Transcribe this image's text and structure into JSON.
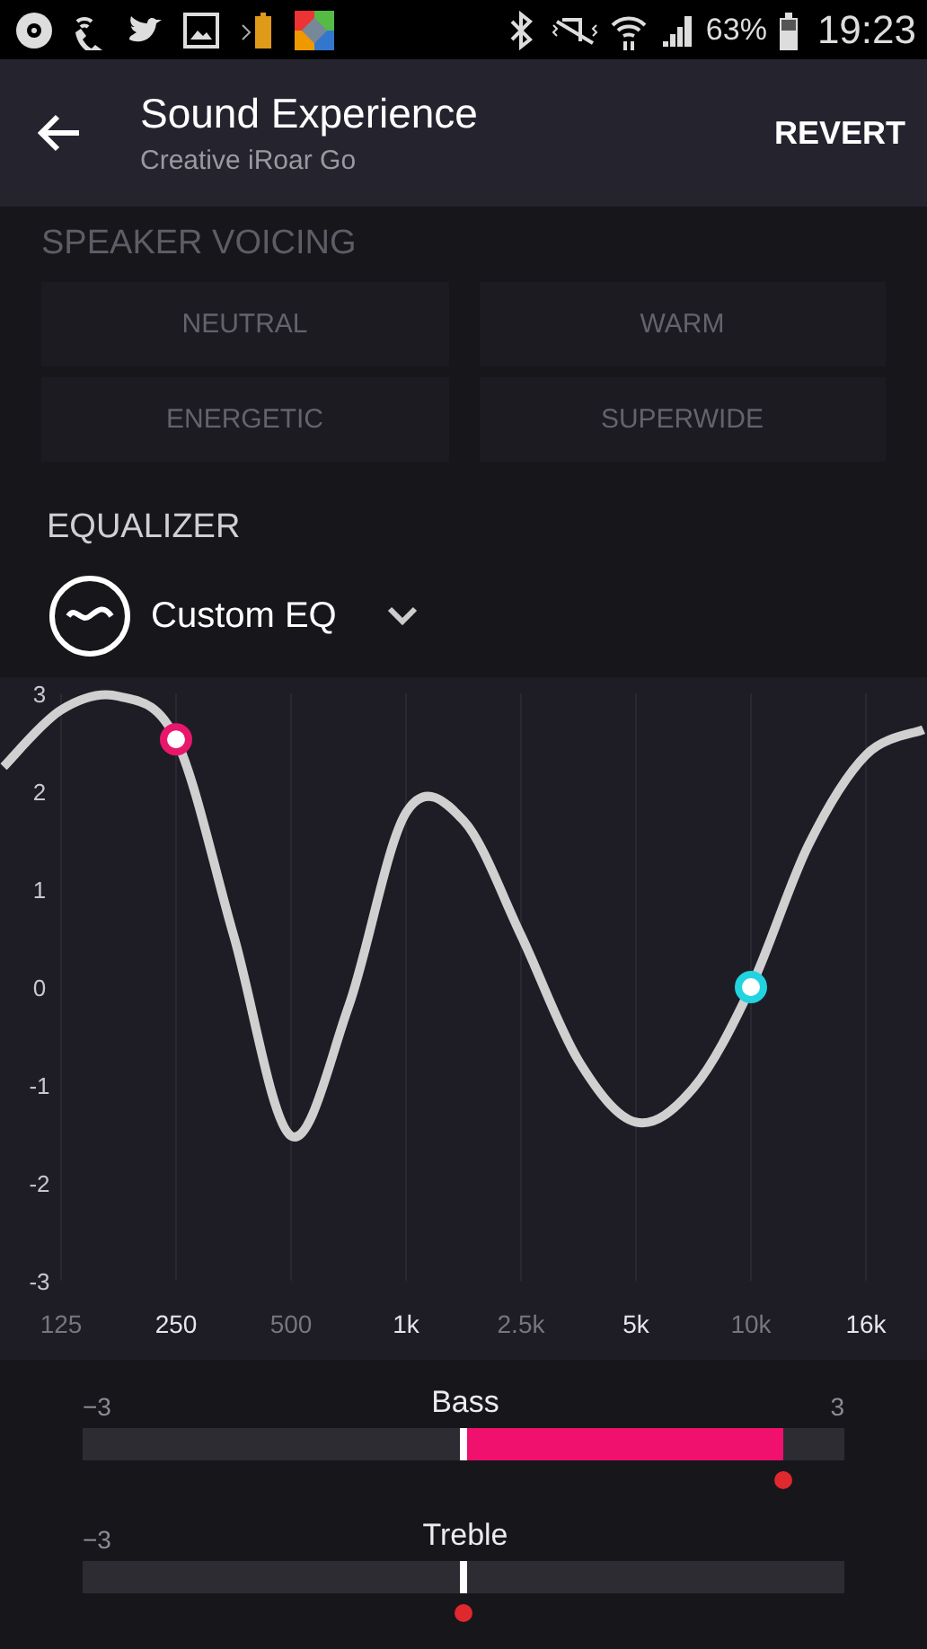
{
  "status_bar": {
    "battery": "63%",
    "time": "19:23"
  },
  "app_bar": {
    "title": "Sound Experience",
    "subtitle": "Creative iRoar Go",
    "action": "REVERT"
  },
  "speaker_voicing": {
    "heading": "SPEAKER VOICING",
    "options": [
      {
        "label": "NEUTRAL",
        "disabled": true
      },
      {
        "label": "WARM",
        "disabled": true
      },
      {
        "label": "ENERGETIC",
        "disabled": true
      },
      {
        "label": "SUPERWIDE",
        "disabled": true
      }
    ]
  },
  "equalizer": {
    "heading": "EQUALIZER",
    "preset": "Custom EQ",
    "chart_data": {
      "type": "line",
      "categories": [
        null,
        "125",
        null,
        "250",
        null,
        "500",
        null,
        "1k",
        null,
        "2.5k",
        null,
        "5k",
        null,
        "10k",
        null,
        "16k",
        null
      ],
      "series": [
        {
          "color": "#d0d0d0",
          "values": [
            2.25,
            2.83,
            2.97,
            2.53,
            0.53,
            -1.52,
            -0.2,
            1.78,
            1.7,
            0.53,
            -0.75,
            -1.38,
            -1.03,
            0,
            1.45,
            2.37,
            2.63
          ]
        }
      ],
      "ylim": [
        -3,
        3
      ],
      "yticks": [
        3,
        2,
        1,
        0,
        -1,
        -2,
        -3
      ],
      "grid": true,
      "annotations": [
        {
          "x": "250"
        },
        {
          "x": "10k"
        }
      ]
    },
    "handles": [
      {
        "color": "#e8176b"
      },
      {
        "color": "#22d3e0"
      }
    ]
  },
  "tone": [
    {
      "label": "Bass",
      "min": "−3",
      "max": "3",
      "level": 0.92
    },
    {
      "label": "Treble",
      "min": "−3",
      "level": 0.5
    }
  ]
}
